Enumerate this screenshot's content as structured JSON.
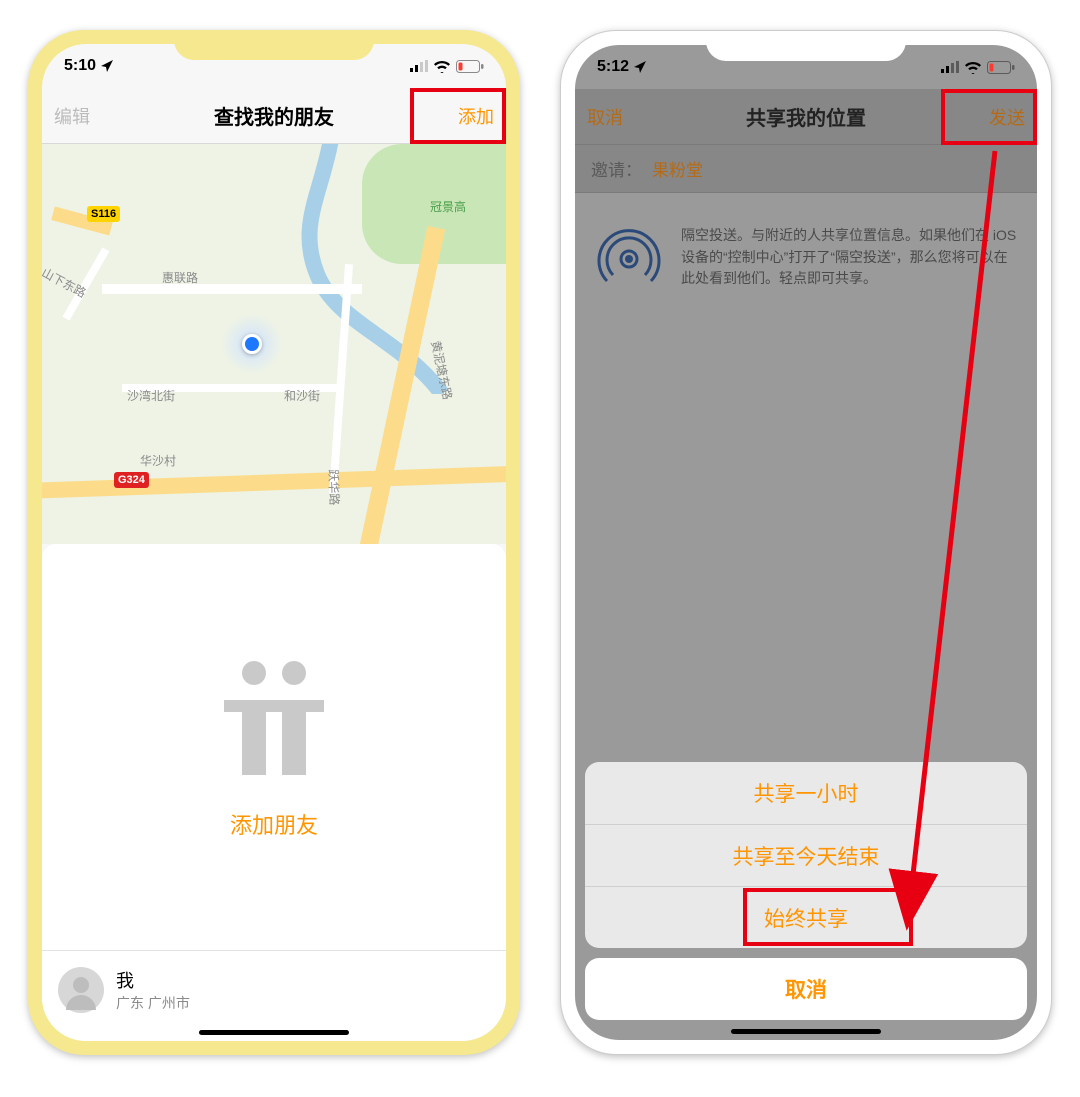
{
  "left": {
    "status_time": "5:10",
    "nav_left": "编辑",
    "nav_title": "查找我的朋友",
    "nav_right": "添加",
    "add_friends_label": "添加朋友",
    "me_name": "我",
    "me_location": "广东 广州市",
    "map": {
      "shield_s": "S116",
      "shield_g": "G324",
      "road_hualian": "惠联路",
      "road_shanxia": "山下东路",
      "road_shawanbei": "沙湾北街",
      "road_heshajie": "和沙街",
      "road_yuehualu": "跃华路",
      "area_huashacun": "华沙村",
      "area_guanjing": "冠景高",
      "area_huangni": "黄泥塘东路"
    }
  },
  "right": {
    "status_time": "5:12",
    "nav_left": "取消",
    "nav_title": "共享我的位置",
    "nav_right": "发送",
    "invite_label": "邀请：",
    "invite_value": "果粉堂",
    "airdrop_text": "隔空投送。与附近的人共享位置信息。如果他们在 iOS 设备的“控制中心”打开了“隔空投送”，那么您将可以在此处看到他们。轻点即可共享。",
    "action_1": "共享一小时",
    "action_2": "共享至今天结束",
    "action_3": "始终共享",
    "action_cancel": "取消"
  }
}
